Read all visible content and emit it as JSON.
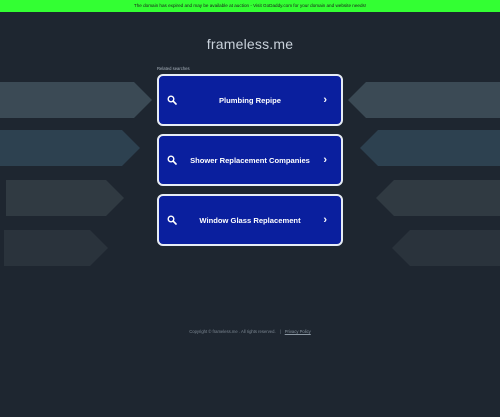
{
  "banner": {
    "text": "The domain has expired and may be available at auction - Visit GoDaddy.com for your domain and website needs!"
  },
  "site": {
    "title": "frameless.me"
  },
  "related": {
    "label": "Related searches",
    "items": [
      {
        "label": "Plumbing Repipe"
      },
      {
        "label": "Shower Replacement Companies"
      },
      {
        "label": "Window Glass Replacement"
      }
    ]
  },
  "footer": {
    "copyright": "Copyright © frameless.me . All rights reserved.",
    "separator": "|",
    "privacy": "Privacy Policy"
  },
  "colors": {
    "background": "#1e2630",
    "banner": "#33ff33",
    "button": "#0a1f9e",
    "button_border": "#e6ecf5"
  },
  "icons": {
    "search": "search-icon",
    "chevron": "chevron-right-icon"
  }
}
